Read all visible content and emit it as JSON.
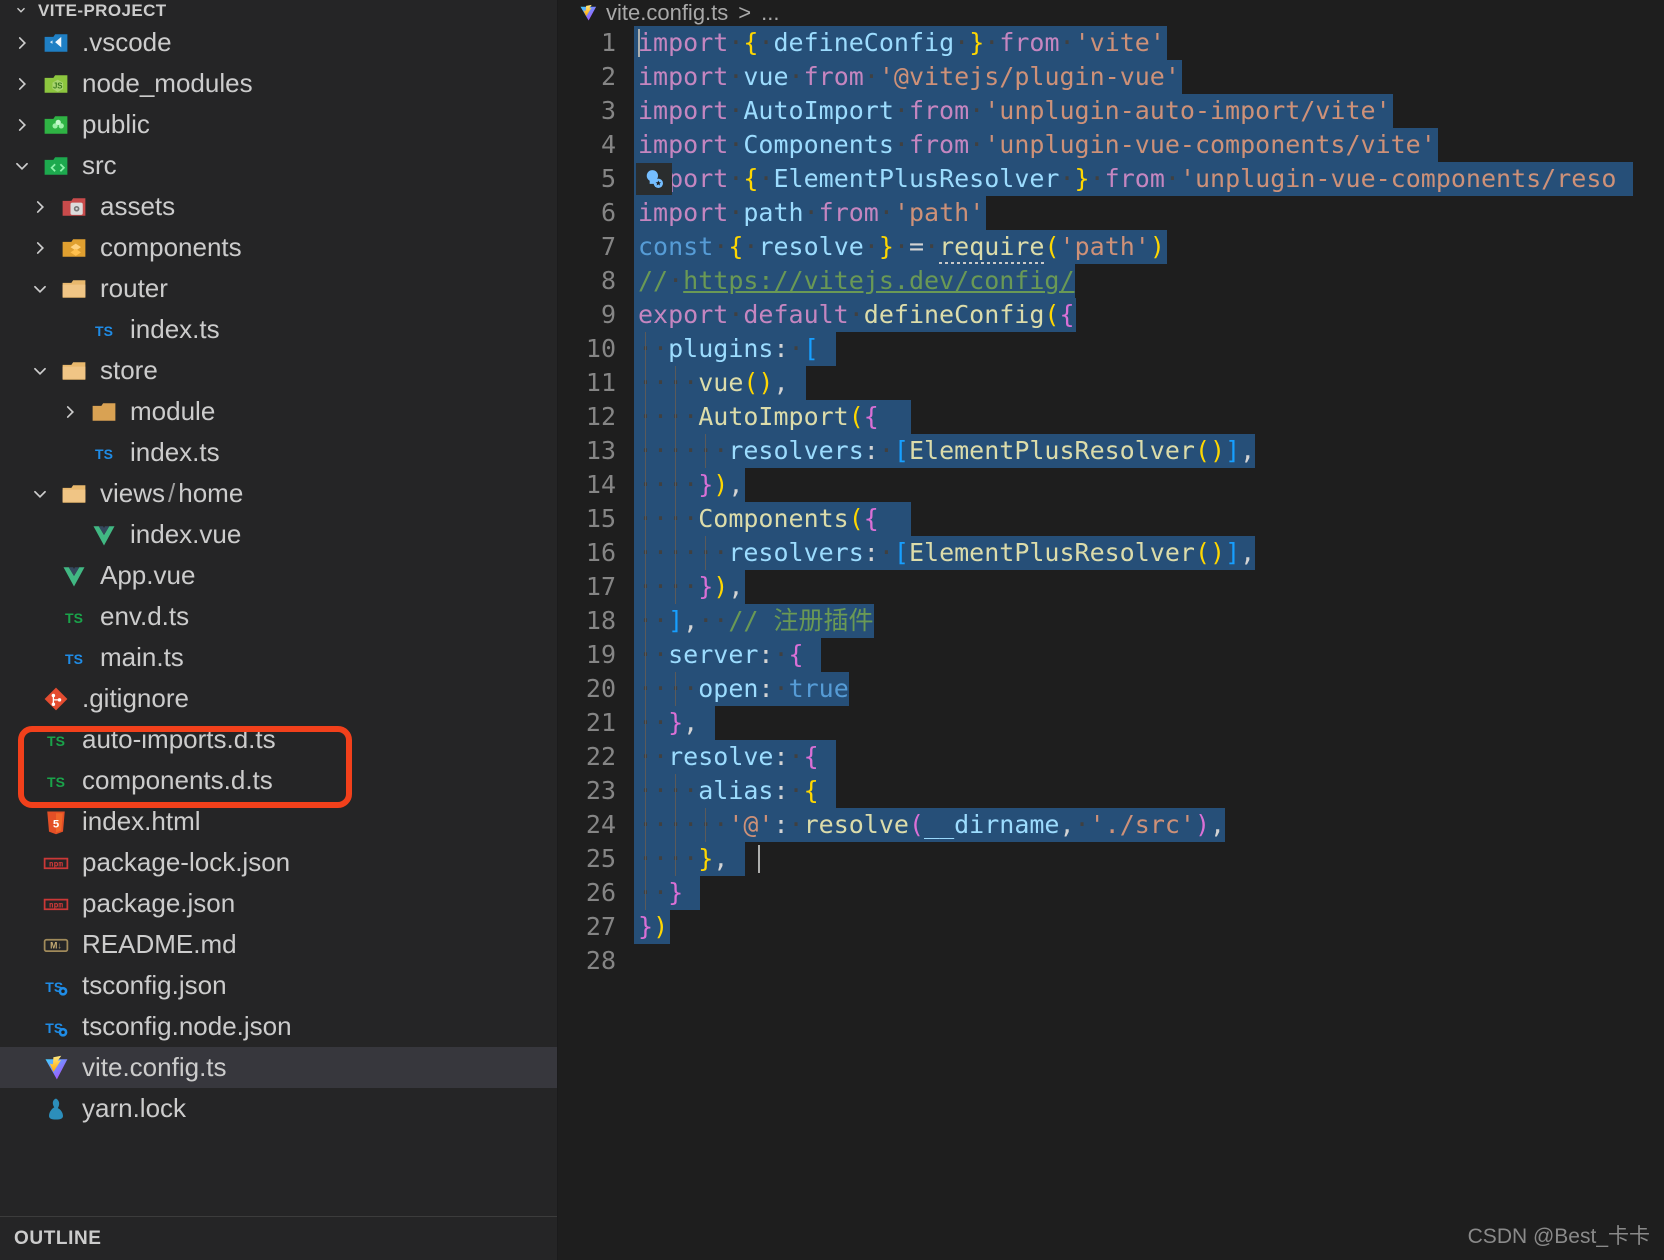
{
  "sidebar": {
    "title": "VITE-PROJECT",
    "outline_label": "OUTLINE",
    "items": [
      {
        "label": ".vscode",
        "icon": "vscode-folder-icon",
        "level": 0,
        "twisty": "collapsed",
        "selected": false
      },
      {
        "label": "node_modules",
        "icon": "node-folder-icon",
        "level": 0,
        "twisty": "collapsed",
        "selected": false
      },
      {
        "label": "public",
        "icon": "public-folder-icon",
        "level": 0,
        "twisty": "collapsed",
        "selected": false
      },
      {
        "label": "src",
        "icon": "src-folder-icon",
        "level": 0,
        "twisty": "expanded",
        "selected": false
      },
      {
        "label": "assets",
        "icon": "assets-folder-icon",
        "level": 1,
        "twisty": "collapsed",
        "selected": false
      },
      {
        "label": "components",
        "icon": "components-folder-icon",
        "level": 1,
        "twisty": "collapsed",
        "selected": false
      },
      {
        "label": "router",
        "icon": "folder-icon",
        "level": 1,
        "twisty": "expanded",
        "selected": false
      },
      {
        "label": "index.ts",
        "icon": "typescript-icon",
        "level": 2,
        "twisty": "none",
        "selected": false
      },
      {
        "label": "store",
        "icon": "folder-icon",
        "level": 1,
        "twisty": "expanded",
        "selected": false
      },
      {
        "label": "module",
        "icon": "folder-closed-icon",
        "level": 2,
        "twisty": "collapsed",
        "selected": false
      },
      {
        "label": "index.ts",
        "icon": "typescript-icon",
        "level": 2,
        "twisty": "none",
        "selected": false
      },
      {
        "label": "views",
        "label2": "home",
        "icon": "folder-icon",
        "level": 1,
        "twisty": "expanded",
        "selected": false
      },
      {
        "label": "index.vue",
        "icon": "vue-icon",
        "level": 2,
        "twisty": "none",
        "selected": false
      },
      {
        "label": "App.vue",
        "icon": "vue-icon",
        "level": 1,
        "twisty": "none",
        "selected": false
      },
      {
        "label": "env.d.ts",
        "icon": "typescript-def-icon",
        "level": 1,
        "twisty": "none",
        "selected": false
      },
      {
        "label": "main.ts",
        "icon": "typescript-icon",
        "level": 1,
        "twisty": "none",
        "selected": false
      },
      {
        "label": ".gitignore",
        "icon": "git-icon",
        "level": 0,
        "twisty": "none",
        "selected": false
      },
      {
        "label": "auto-imports.d.ts",
        "icon": "typescript-def-icon",
        "level": 0,
        "twisty": "none",
        "selected": false
      },
      {
        "label": "components.d.ts",
        "icon": "typescript-def-icon",
        "level": 0,
        "twisty": "none",
        "selected": false
      },
      {
        "label": "index.html",
        "icon": "html-icon",
        "level": 0,
        "twisty": "none",
        "selected": false
      },
      {
        "label": "package-lock.json",
        "icon": "npm-icon",
        "level": 0,
        "twisty": "none",
        "selected": false
      },
      {
        "label": "package.json",
        "icon": "npm-icon",
        "level": 0,
        "twisty": "none",
        "selected": false
      },
      {
        "label": "README.md",
        "icon": "markdown-icon",
        "level": 0,
        "twisty": "none",
        "selected": false
      },
      {
        "label": "tsconfig.json",
        "icon": "tsconfig-icon",
        "level": 0,
        "twisty": "none",
        "selected": false
      },
      {
        "label": "tsconfig.node.json",
        "icon": "tsconfig-icon",
        "level": 0,
        "twisty": "none",
        "selected": false
      },
      {
        "label": "vite.config.ts",
        "icon": "vite-icon",
        "level": 0,
        "twisty": "none",
        "selected": true
      },
      {
        "label": "yarn.lock",
        "icon": "yarn-icon",
        "level": 0,
        "twisty": "none",
        "selected": false
      }
    ]
  },
  "editor": {
    "breadcrumb_file": "vite.config.ts",
    "breadcrumb_sep": ">",
    "breadcrumb_rest": "...",
    "file_icon": "vite-icon",
    "lightbulb_icon": "lightbulb-code-action-icon",
    "line_numbers": [
      "1",
      "2",
      "3",
      "4",
      "5",
      "6",
      "7",
      "8",
      "9",
      "10",
      "11",
      "12",
      "13",
      "14",
      "15",
      "16",
      "17",
      "18",
      "19",
      "20",
      "21",
      "22",
      "23",
      "24",
      "25",
      "26",
      "27",
      "28"
    ],
    "lines": [
      "import { defineConfig } from 'vite'",
      "import vue from '@vitejs/plugin-vue'",
      "import AutoImport from 'unplugin-auto-import/vite'",
      "import Components from 'unplugin-vue-components/vite'",
      "import { ElementPlusResolver } from 'unplugin-vue-components/reso",
      "import path from 'path'",
      "const { resolve } = require('path')",
      "// https://vitejs.dev/config/",
      "export default defineConfig({",
      "  plugins: [",
      "    vue(),",
      "    AutoImport({",
      "      resolvers: [ElementPlusResolver()],",
      "    }),",
      "    Components({",
      "      resolvers: [ElementPlusResolver()],",
      "    }),",
      "  ],  // 注册插件",
      "  server: {",
      "    open: true",
      "  },",
      "  resolve: {",
      "    alias: {",
      "      '@': resolve(__dirname, './src'),",
      "    },",
      "  }",
      "})",
      ""
    ],
    "comment_url": "https://vitejs.dev/config/",
    "comment_chinese": "// 注册插件"
  },
  "annotation": {
    "highlight_color": "#f2401b",
    "highlighted_files": [
      "auto-imports.d.ts",
      "components.d.ts"
    ]
  },
  "watermark": "CSDN @Best_卡卡",
  "colors": {
    "sidebar_bg": "#252526",
    "editor_bg": "#1e1e1e",
    "selection_bg": "#264f78",
    "row_selected_bg": "#37373d",
    "text": "#cccccc"
  }
}
